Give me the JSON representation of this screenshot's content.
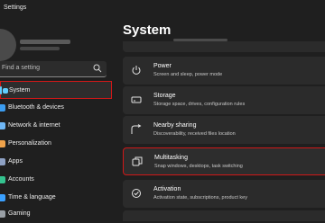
{
  "window": {
    "title": "Settings"
  },
  "search": {
    "placeholder": "Find a setting"
  },
  "sidebar": {
    "items": [
      {
        "label": "System",
        "icon": "monitor-icon",
        "color": "#60cdff",
        "selected": true
      },
      {
        "label": "Bluetooth & devices",
        "icon": "bluetooth-icon",
        "color": "#3b9cf0"
      },
      {
        "label": "Network & internet",
        "icon": "wifi-icon",
        "color": "#6fb7f5"
      },
      {
        "label": "Personalization",
        "icon": "brush-icon",
        "color": "#f0a34b"
      },
      {
        "label": "Apps",
        "icon": "apps-icon",
        "color": "#8ea1c4"
      },
      {
        "label": "Accounts",
        "icon": "person-icon",
        "color": "#34c38f"
      },
      {
        "label": "Time & language",
        "icon": "globe-clock-icon",
        "color": "#3aa0ff"
      },
      {
        "label": "Gaming",
        "icon": "gamepad-icon",
        "color": "#9aa0a6"
      }
    ]
  },
  "main": {
    "title": "System",
    "cards": [
      {
        "title": "Power",
        "subtitle": "Screen and sleep, power mode",
        "icon": "power-icon"
      },
      {
        "title": "Storage",
        "subtitle": "Storage space, drives, configuration rules",
        "icon": "storage-icon"
      },
      {
        "title": "Nearby sharing",
        "subtitle": "Discoverability, received files location",
        "icon": "share-icon"
      },
      {
        "title": "Multitasking",
        "subtitle": "Snap windows, desktops, task switching",
        "icon": "multitasking-icon",
        "highlight": true
      },
      {
        "title": "Activation",
        "subtitle": "Activation state, subscriptions, product key",
        "icon": "activation-icon"
      }
    ]
  },
  "colors": {
    "highlight": "#d01818",
    "accent": "#60cdff",
    "background": "#1f1f1f",
    "card": "#2b2b2b"
  }
}
